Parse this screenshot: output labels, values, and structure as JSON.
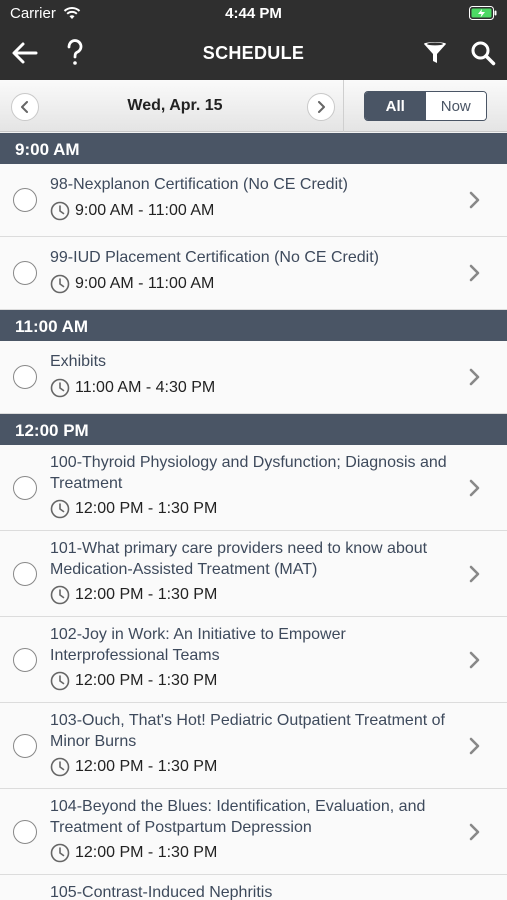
{
  "status": {
    "carrier": "Carrier",
    "time": "4:44 PM"
  },
  "nav": {
    "title": "SCHEDULE",
    "back_icon": "back-arrow-icon",
    "help_icon": "question-mark-icon",
    "filter_icon": "filter-icon",
    "search_icon": "search-icon"
  },
  "datebar": {
    "date": "Wed, Apr. 15",
    "seg_all": "All",
    "seg_now": "Now"
  },
  "colors": {
    "header_bg": "#2f2f2f",
    "section_bg": "#4a5565",
    "title_text": "#3e4a5c"
  },
  "sections": [
    {
      "header": "9:00 AM",
      "items": [
        {
          "title": "98-Nexplanon Certification (No CE Credit)",
          "time": "9:00 AM - 11:00 AM"
        },
        {
          "title": "99-IUD Placement Certification (No CE Credit)",
          "time": "9:00 AM - 11:00 AM"
        }
      ]
    },
    {
      "header": "11:00 AM",
      "items": [
        {
          "title": "Exhibits",
          "time": "11:00 AM - 4:30 PM"
        }
      ]
    },
    {
      "header": "12:00 PM",
      "items": [
        {
          "title": "100-Thyroid Physiology and Dysfunction; Diagnosis and Treatment",
          "time": "12:00 PM - 1:30 PM"
        },
        {
          "title": "101-What primary care providers need to know about Medication-Assisted Treatment (MAT)",
          "time": "12:00 PM - 1:30 PM"
        },
        {
          "title": "102-Joy in Work: An Initiative to Empower Interprofessional Teams",
          "time": "12:00 PM - 1:30 PM"
        },
        {
          "title": "103-Ouch, That's Hot! Pediatric Outpatient Treatment of Minor Burns",
          "time": "12:00 PM - 1:30 PM"
        },
        {
          "title": "104-Beyond the Blues: Identification, Evaluation, and Treatment of Postpartum Depression",
          "time": "12:00 PM - 1:30 PM"
        },
        {
          "title": "105-Contrast-Induced Nephritis",
          "time": ""
        }
      ]
    }
  ]
}
